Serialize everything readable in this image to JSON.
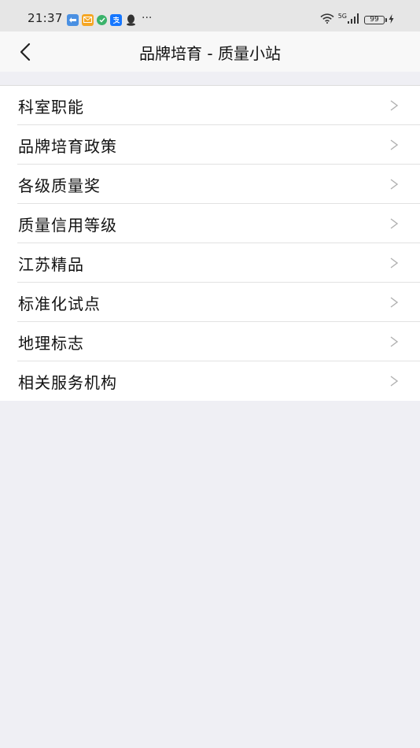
{
  "status_bar": {
    "time": "21:37",
    "more": "···",
    "network": "5G",
    "battery": "99"
  },
  "nav": {
    "title": "品牌培育 - 质量小站"
  },
  "menu": {
    "items": [
      {
        "label": "科室职能"
      },
      {
        "label": "品牌培育政策"
      },
      {
        "label": "各级质量奖"
      },
      {
        "label": "质量信用等级"
      },
      {
        "label": "江苏精品"
      },
      {
        "label": "标准化试点"
      },
      {
        "label": "地理标志"
      },
      {
        "label": "相关服务机构"
      }
    ]
  },
  "colors": {
    "background": "#efeff4",
    "status_bar": "#e6e6e6",
    "nav_bar": "#f8f8f8",
    "list_bg": "#ffffff",
    "chevron": "#b0b0b0"
  }
}
